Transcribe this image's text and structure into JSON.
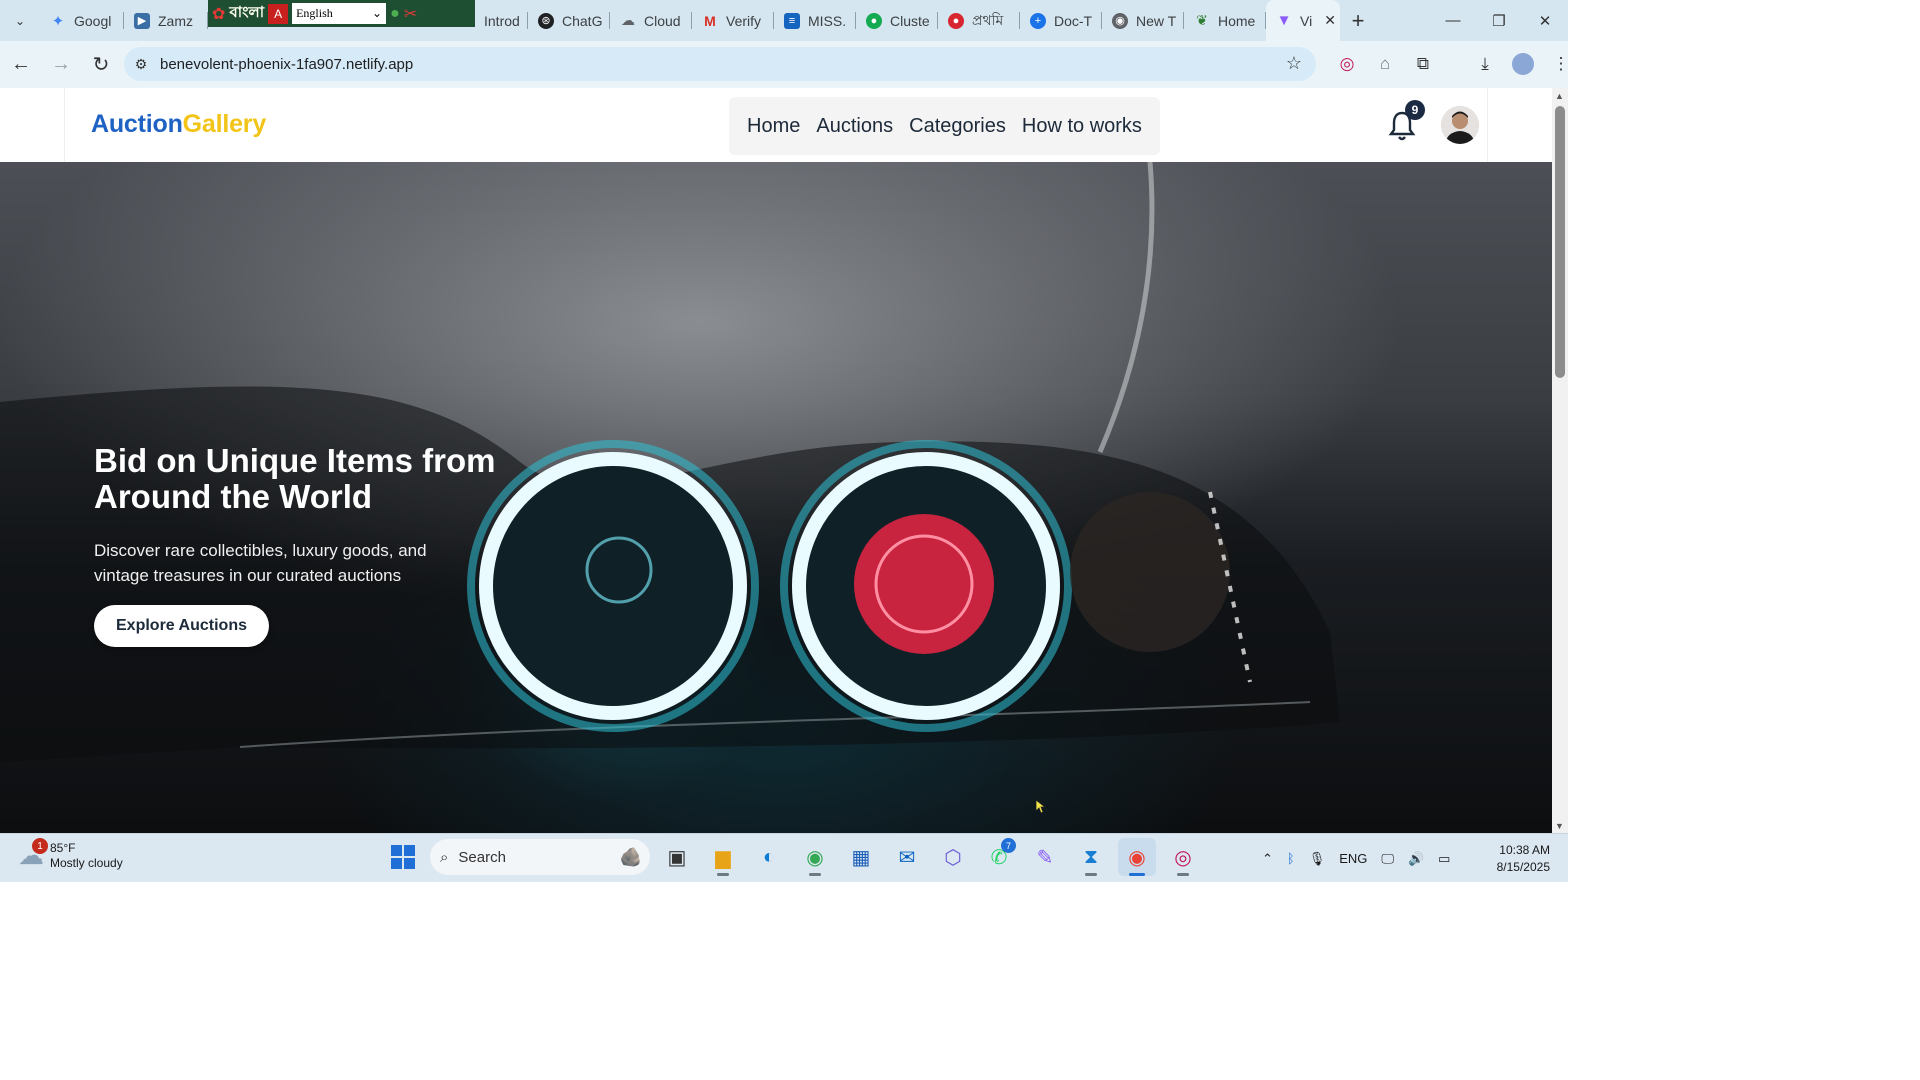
{
  "browser": {
    "tabs": [
      {
        "label": "Googl",
        "icon": "gemini-icon",
        "color": "#4285f4"
      },
      {
        "label": "Zamz",
        "icon": "zamzar-icon",
        "color": "#3a6ea5"
      },
      {
        "label": "Introd",
        "icon": "page-icon",
        "color": "#888888"
      },
      {
        "label": "ChatG",
        "icon": "chatgpt-icon",
        "color": "#202124"
      },
      {
        "label": "Cloud",
        "icon": "cloud-icon",
        "color": "#5f6368"
      },
      {
        "label": "Verify",
        "icon": "gmail-icon",
        "color": "#d93025"
      },
      {
        "label": "MISS.",
        "icon": "stack-icon",
        "color": "#1565c0"
      },
      {
        "label": "Cluste",
        "icon": "mongodb-icon",
        "color": "#13aa52"
      },
      {
        "label": "প্রথমি",
        "icon": "news-icon",
        "color": "#d7262f"
      },
      {
        "label": "Doc-T",
        "icon": "add-circle-icon",
        "color": "#1a73e8"
      },
      {
        "label": "New T",
        "icon": "chrome-icon",
        "color": "#5f6368"
      },
      {
        "label": "Home",
        "icon": "leaf-icon",
        "color": "#2e7d32"
      },
      {
        "label": "Vi",
        "icon": "vite-icon",
        "color": "#8b5cf6"
      }
    ],
    "ime": {
      "script_label": "বাংলা",
      "language": "English"
    },
    "url": "benevolent-phoenix-1fa907.netlify.app"
  },
  "site": {
    "logo_part1": "Auction",
    "logo_part2": "Gallery",
    "nav": [
      "Home",
      "Auctions",
      "Categories",
      "How to works"
    ],
    "notification_count": "9"
  },
  "hero": {
    "title": "Bid on Unique Items from Around the World",
    "subtitle": "Discover rare collectibles, luxury goods, and vintage treasures in our curated auctions",
    "cta": "Explore Auctions"
  },
  "taskbar": {
    "weather_badge": "1",
    "temperature": "85°F",
    "condition": "Mostly cloudy",
    "search_placeholder": "Search",
    "whatsapp_badge": "7",
    "language": "ENG",
    "time": "10:38 AM",
    "date": "8/15/2025"
  },
  "colors": {
    "logo_primary": "#1e63c4",
    "logo_accent": "#f2c417",
    "tabstrip": "#d5e6f0",
    "omnibox": "#d6ebf7"
  }
}
